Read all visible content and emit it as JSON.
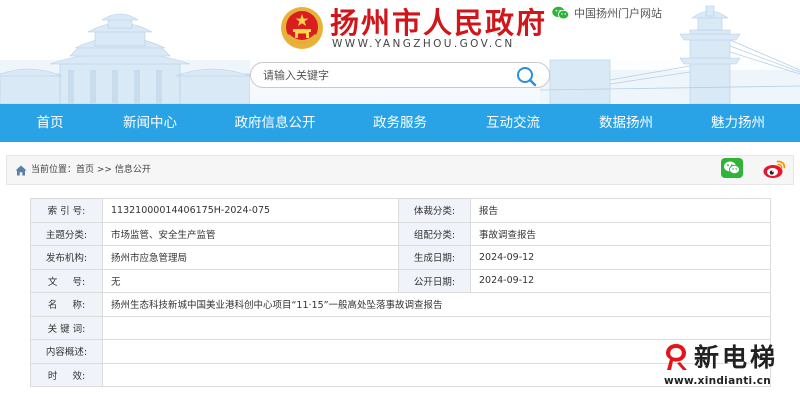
{
  "header": {
    "site_title": "扬州市人民政府",
    "site_url": "WWW.YANGZHOU.GOV.CN",
    "portal_link": "中国扬州门户网站",
    "search": {
      "placeholder": "请输入关键字"
    }
  },
  "nav": [
    {
      "label": "首页"
    },
    {
      "label": "新闻中心"
    },
    {
      "label": "政府信息公开"
    },
    {
      "label": "政务服务"
    },
    {
      "label": "互动交流"
    },
    {
      "label": "数据扬州"
    },
    {
      "label": "魅力扬州"
    }
  ],
  "breadcrumb": {
    "prefix": "当前位置：",
    "home": "首页",
    "separator": " >> ",
    "current": "信息公开"
  },
  "info": {
    "index_no_label": "索 引 号:",
    "index_no": "11321000014406175H-2024-075",
    "genre_label": "体裁分类:",
    "genre": "报告",
    "topic_label": "主题分类:",
    "topic": "市场监管、安全生产监管",
    "org_cat_label": "组配分类:",
    "org_cat": "事故调查报告",
    "publisher_label": "发布机构:",
    "publisher": "扬州市应急管理局",
    "created_label": "生成日期:",
    "created": "2024-09-12",
    "doc_no_label": "文     号:",
    "doc_no": "无",
    "published_label": "公开日期:",
    "published": "2024-09-12",
    "name_label": "名     称:",
    "name": "扬州生态科技新城中国美业港科创中心项目“11·15”一般高处坠落事故调查报告",
    "keywords_label": "关 键 词:",
    "keywords": "",
    "summary_label": "内容概述:",
    "summary": "",
    "validity_label": "时     效:",
    "validity": ""
  },
  "watermark": {
    "name": "新电梯",
    "url": "www.xindianti.cn"
  },
  "colors": {
    "nav_blue": "#29a3e6",
    "title_red": "#d0161b",
    "label_bg": "#f0f4fa",
    "wechat_green": "#2fb43a",
    "weibo_red": "#e6162d"
  }
}
